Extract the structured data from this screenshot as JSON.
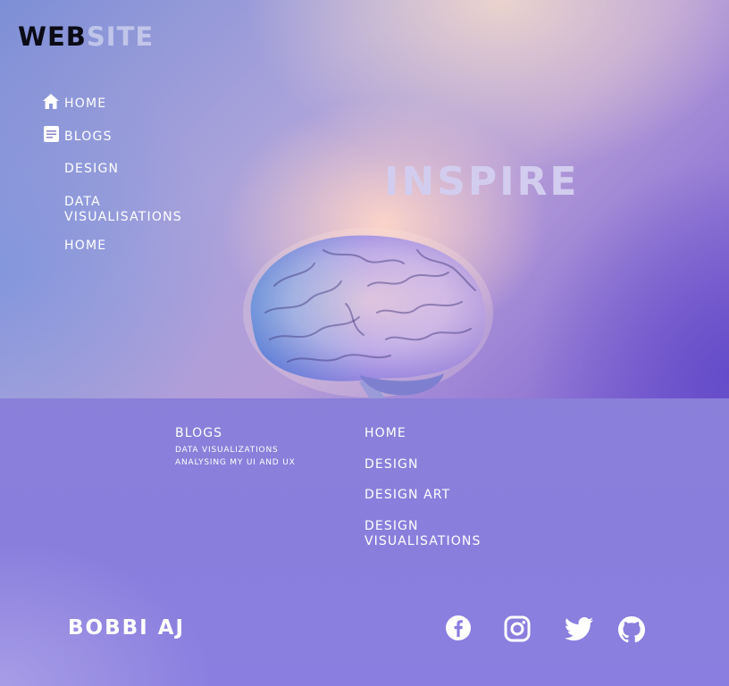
{
  "header": {
    "logo_bold": "WEB",
    "logo_light": "SITE"
  },
  "sidebar": {
    "items": [
      {
        "label": "HOME",
        "icon": "home-icon"
      },
      {
        "label": "BLOGS",
        "icon": "document-icon"
      },
      {
        "label": "DESIGN"
      },
      {
        "label": "DATA VISUALISATIONS"
      },
      {
        "label": "HOME"
      }
    ]
  },
  "hero": {
    "headline": "INSPIRE",
    "image": "brain-illustration"
  },
  "footer": {
    "blogs_heading": "BLOGS",
    "blogs_lines": [
      "DATA VISUALIZATIONS",
      "ANALYSING MY UI AND UX"
    ],
    "links": [
      "HOME",
      "DESIGN",
      "DESIGN ART",
      "DESIGN VISUALISATIONS"
    ],
    "owner": "BOBBI AJ",
    "social": [
      "facebook-icon",
      "instagram-icon",
      "twitter-icon",
      "github-icon"
    ]
  },
  "colors": {
    "logo_dark": "#0b0b16",
    "headline": "#d2cdee",
    "footer_bg": "#8a7ee0"
  }
}
